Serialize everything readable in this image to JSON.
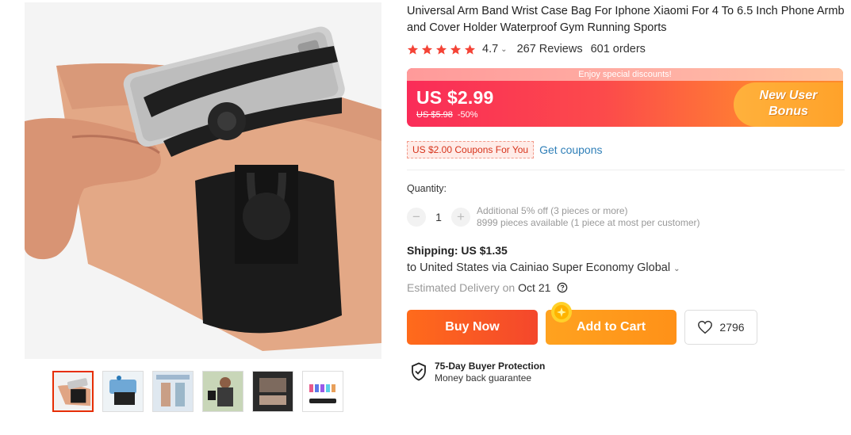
{
  "product": {
    "title": "Universal Arm Band Wrist Case Bag For Iphone Xiaomi For 4 To 6.5 Inch Phone Armb and Cover Holder Waterproof Gym Running Sports",
    "rating": "4.7",
    "stars": 5,
    "reviews": "267 Reviews",
    "orders": "601 orders"
  },
  "price": {
    "banner_top": "Enjoy special discounts!",
    "current": "US $2.99",
    "original": "US $5.98",
    "discount": "-50%",
    "badge_line1": "New User",
    "badge_line2": "Bonus"
  },
  "coupon": {
    "tag": "US $2.00 Coupons For You",
    "link": "Get coupons"
  },
  "quantity": {
    "label": "Quantity:",
    "value": "1",
    "note1": "Additional 5% off (3 pieces or more)",
    "note2": "8999 pieces available (1 piece at most per customer)"
  },
  "shipping": {
    "title": "Shipping: US $1.35",
    "route": "to United States via Cainiao Super Economy Global",
    "delivery_label": "Estimated Delivery on",
    "delivery_date": "Oct 21"
  },
  "actions": {
    "buy_now": "Buy Now",
    "add_to_cart": "Add to Cart",
    "wishlist_count": "2796"
  },
  "protection": {
    "title": "75-Day Buyer Protection",
    "subtitle": "Money back guarantee"
  },
  "gallery": {
    "thumbnails": 6,
    "active_index": 0
  },
  "colors": {
    "star": "#f44336",
    "accent": "#e62e04",
    "link": "#2f7fb8",
    "buy_now": "#f4472c",
    "add_to_cart": "#ff9118"
  }
}
